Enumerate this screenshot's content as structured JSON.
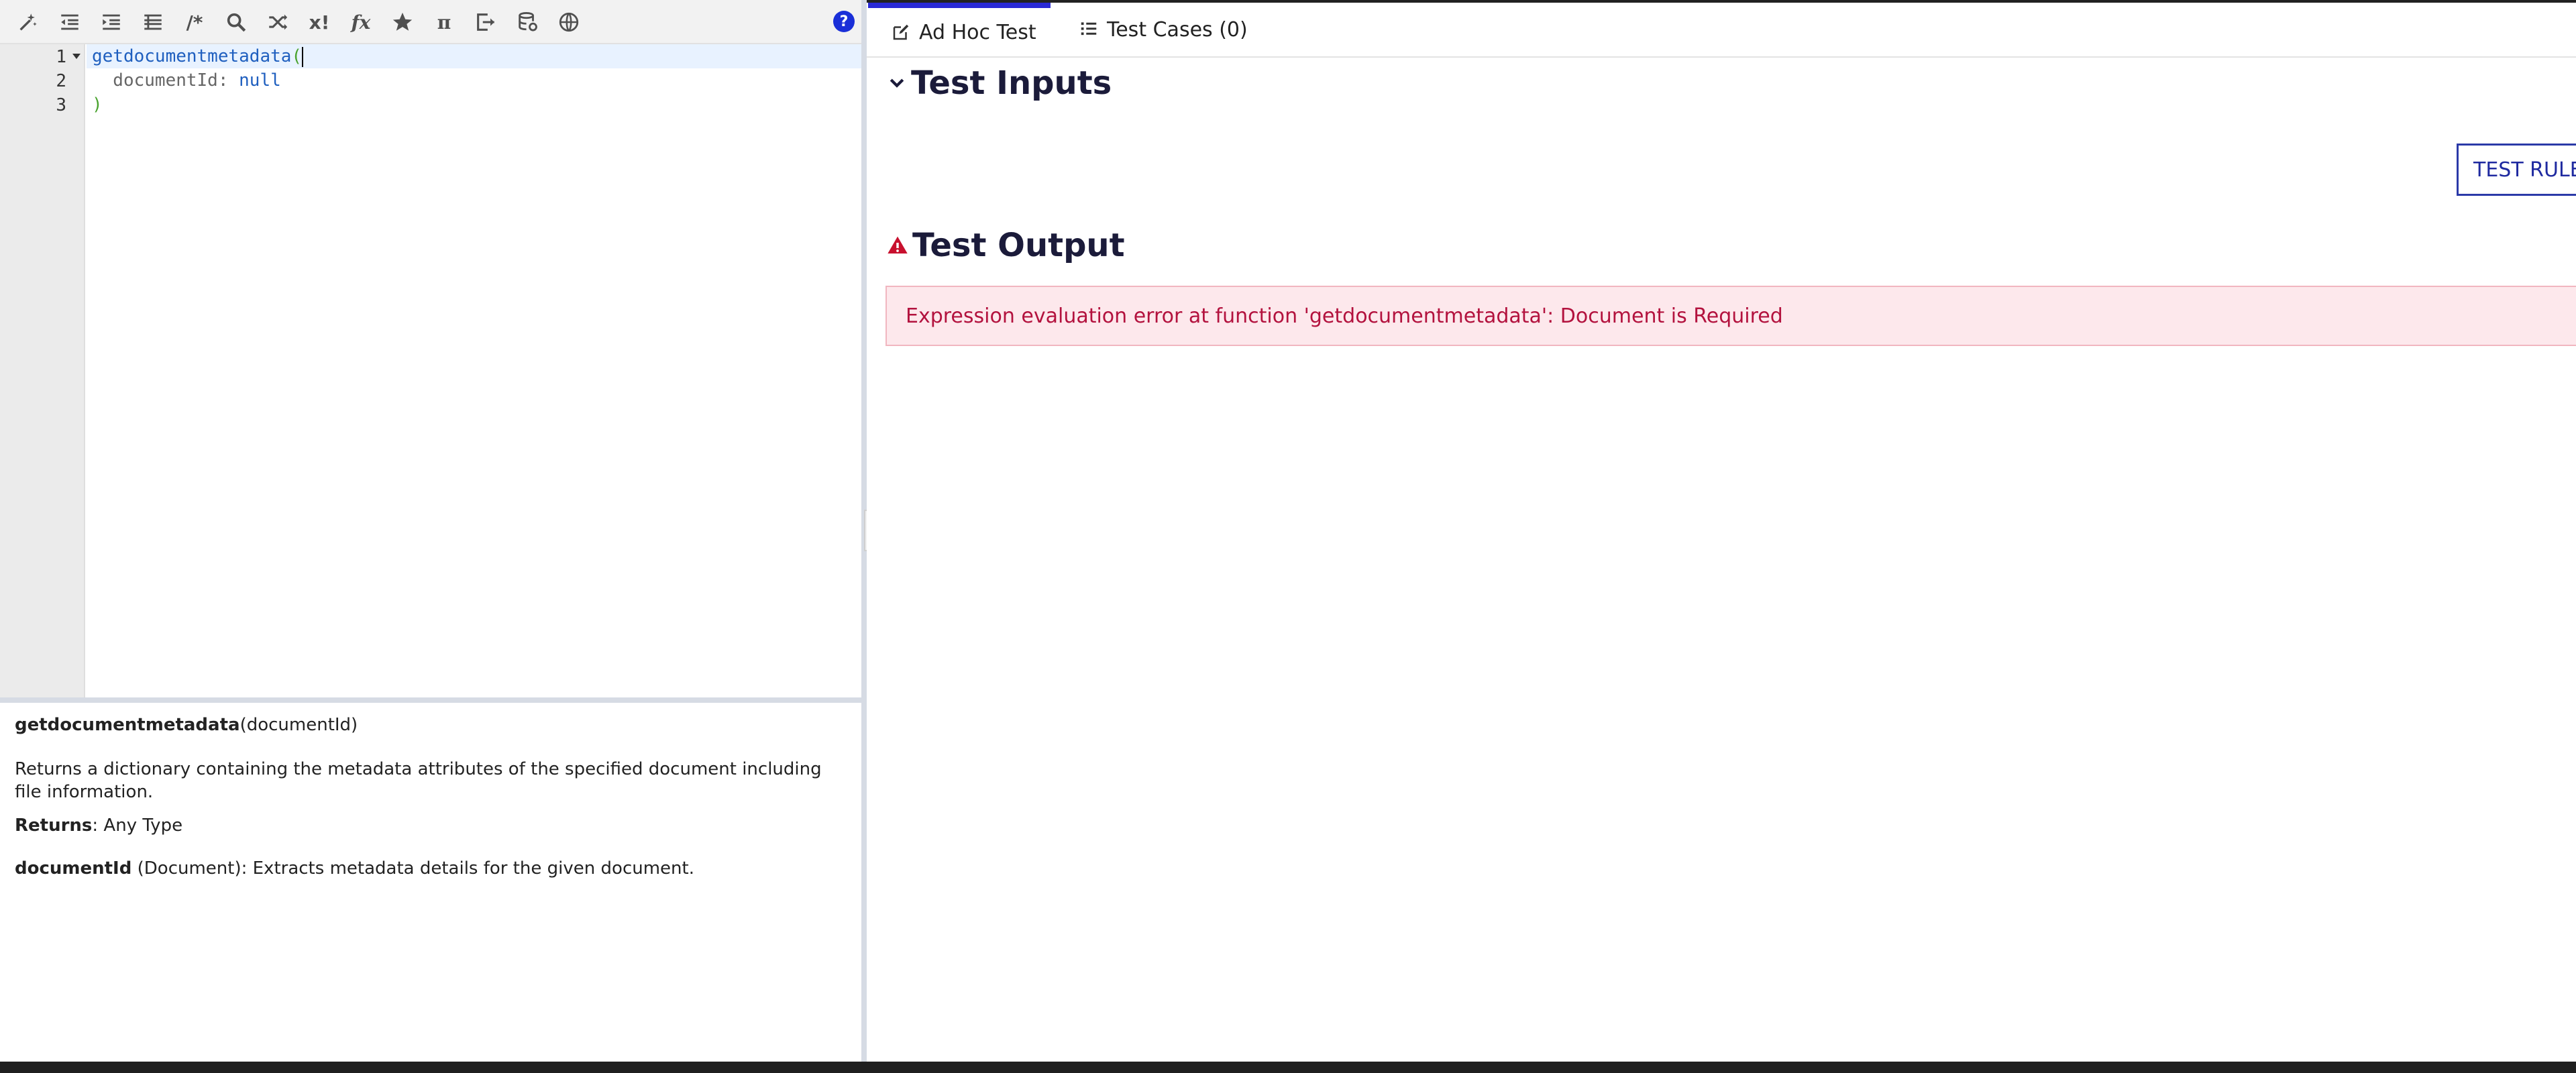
{
  "toolbar": {
    "buttons": [
      {
        "icon": "magic-wand-icon"
      },
      {
        "icon": "outdent-icon"
      },
      {
        "icon": "indent-icon"
      },
      {
        "icon": "list-icon"
      },
      {
        "icon": "comment-icon",
        "label": "/*"
      },
      {
        "icon": "search-icon"
      },
      {
        "icon": "shuffle-icon"
      },
      {
        "icon": "xfunction-icon",
        "label": "x!"
      },
      {
        "icon": "fx-icon",
        "label": "fx"
      },
      {
        "icon": "star-icon"
      },
      {
        "icon": "pi-icon",
        "label": "π"
      },
      {
        "icon": "export-icon"
      },
      {
        "icon": "database-icon"
      },
      {
        "icon": "globe-icon"
      }
    ],
    "help_label": "?"
  },
  "editor": {
    "line_numbers": [
      "1",
      "2",
      "3"
    ],
    "lines": {
      "l1_fn": "getdocumentmetadata",
      "l1_paren": "(",
      "l2_key": "  documentId",
      "l2_sep": ": ",
      "l2_val": "null",
      "l3_paren": ")"
    }
  },
  "doc": {
    "fn_name": "getdocumentmetadata",
    "fn_args": "(documentId)",
    "description": "Returns a dictionary containing the metadata attributes of the specified document including file information.",
    "returns_label": "Returns",
    "returns_value": ": Any Type",
    "param_name": "documentId",
    "param_desc": " (Document): Extracts metadata details for the given document."
  },
  "tabs": {
    "adhoc": "Ad Hoc Test",
    "testcases": "Test Cases (0)"
  },
  "sections": {
    "inputs_title": "Test Inputs",
    "output_title": "Test Output"
  },
  "test_rule_button": "TEST RULE",
  "error_message": "Expression evaluation error at function 'getdocumentmetadata': Document is Required",
  "colors": {
    "accent": "#2a2ad6",
    "error_text": "#b3123e",
    "error_bg": "#fde8ec",
    "warning_icon": "#c8102e"
  }
}
